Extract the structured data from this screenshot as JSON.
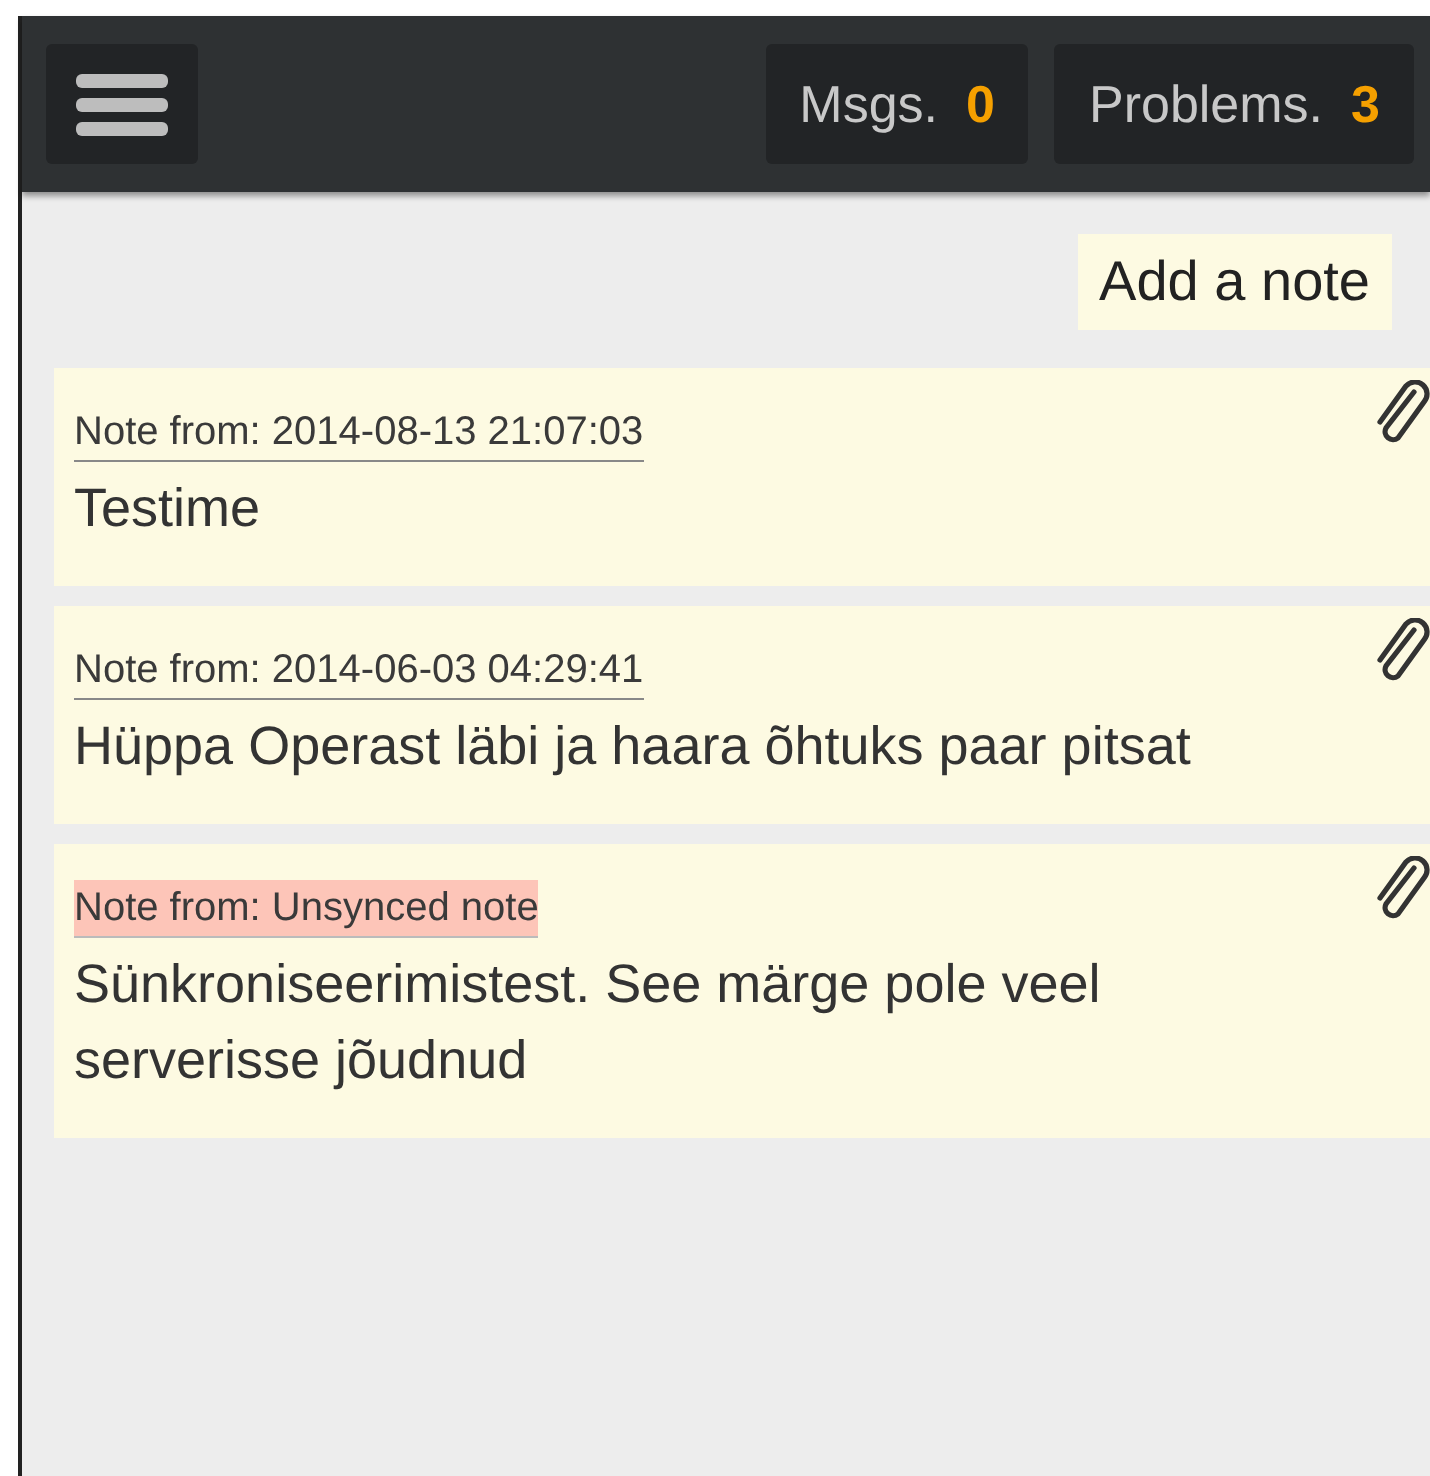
{
  "top_bar": {
    "counters": [
      {
        "label": "Msgs.",
        "count": "0"
      },
      {
        "label": "Problems.",
        "count": "3"
      }
    ]
  },
  "add_note": "Add a note",
  "notes": [
    {
      "header": "Note from: 2014-08-13 21:07:03",
      "text": "Testime",
      "unsynced": false
    },
    {
      "header": "Note from: 2014-06-03 04:29:41",
      "text": "Hüppa Operast läbi ja haara õhtuks paar pitsat",
      "unsynced": false
    },
    {
      "header": "Note from: Unsynced note",
      "text": "Sünkroniseerimistest. See märge pole veel serverisse jõudnud",
      "unsynced": true
    }
  ]
}
